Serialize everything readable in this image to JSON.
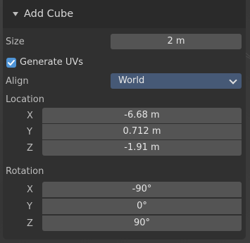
{
  "panel": {
    "title": "Add Cube"
  },
  "size": {
    "label": "Size",
    "value": "2 m"
  },
  "generate_uvs": {
    "label": "Generate UVs",
    "checked": true
  },
  "align": {
    "label": "Align",
    "value": "World"
  },
  "location": {
    "label": "Location",
    "x_label": "X",
    "y_label": "Y",
    "z_label": "Z",
    "x": "-6.68 m",
    "y": "0.712 m",
    "z": "-1.91 m"
  },
  "rotation": {
    "label": "Rotation",
    "x_label": "X",
    "y_label": "Y",
    "z_label": "Z",
    "x": "-90°",
    "y": "0°",
    "z": "90°"
  },
  "colors": {
    "panel_bg": "#303030",
    "field_bg": "#545454",
    "select_bg": "#465976",
    "checkbox_accent": "#4f94d6"
  }
}
